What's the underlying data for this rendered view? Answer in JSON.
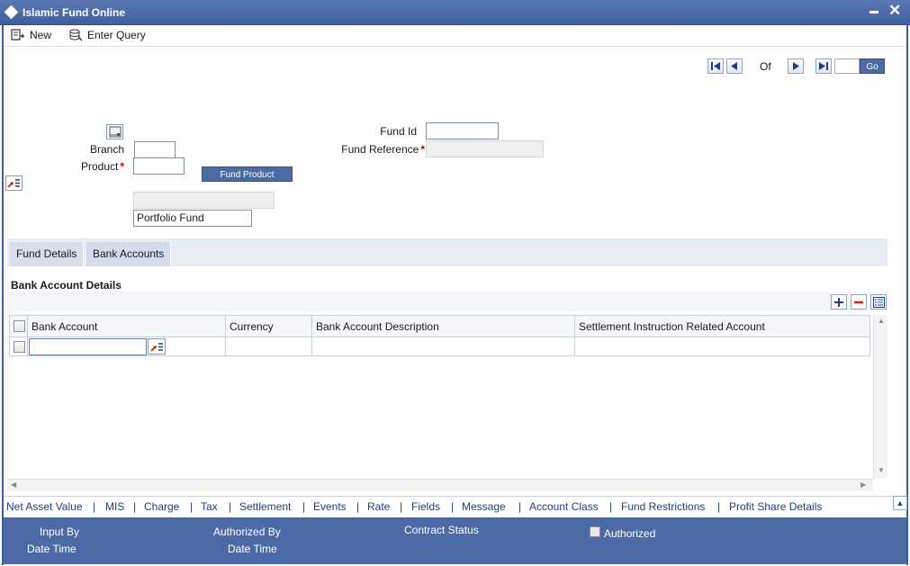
{
  "window": {
    "title": "Islamic Fund Online"
  },
  "toolbar": {
    "new_label": "New",
    "enter_query_label": "Enter Query"
  },
  "navigation": {
    "of_label": "Of",
    "go_label": "Go"
  },
  "form": {
    "branch_label": "Branch",
    "product_label": "Product",
    "required_mark": "*",
    "fund_product_button": "Fund Product",
    "portfolio_value": "Portfolio Fund",
    "fund_id_label": "Fund Id",
    "fund_reference_label": "Fund Reference"
  },
  "tabs": [
    {
      "label": "Fund Details"
    },
    {
      "label": "Bank Accounts"
    }
  ],
  "section": {
    "title": "Bank Account Details"
  },
  "table": {
    "columns": [
      "Bank Account",
      "Currency",
      "Bank Account Description",
      "Settlement Instruction Related Account"
    ]
  },
  "links": [
    "Net Asset Value",
    "MIS",
    "Charge",
    "Tax",
    "Settlement",
    "Events",
    "Rate",
    "Fields",
    "Message",
    "Account Class",
    "Fund Restrictions",
    "Profit Share Details"
  ],
  "link_separator": "|",
  "footer": {
    "input_by": "Input By",
    "date_time_1": "Date Time",
    "authorized_by": "Authorized By",
    "date_time_2": "Date Time",
    "contract_status": "Contract Status",
    "authorized": "Authorized"
  },
  "colors": {
    "accent": "#4b6aa6",
    "link": "#1c3f86",
    "required": "#cc0000"
  }
}
